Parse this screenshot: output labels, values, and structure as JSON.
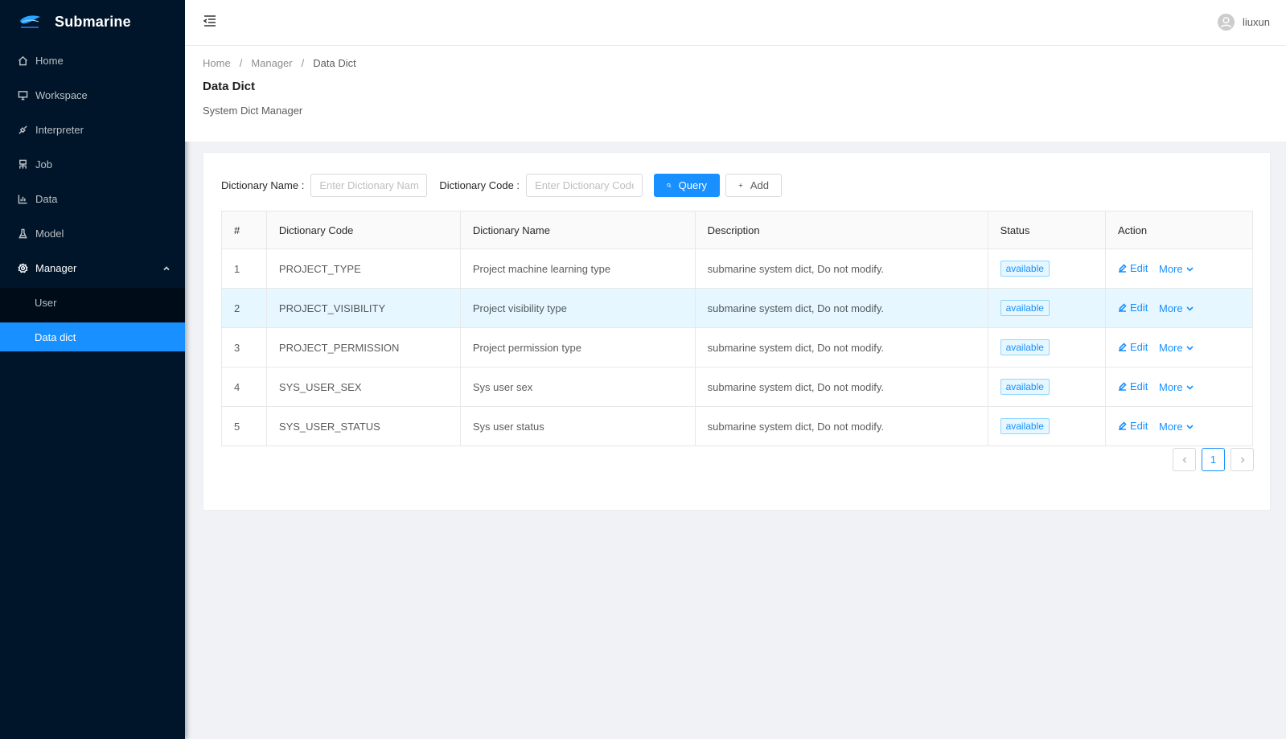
{
  "app": {
    "title": "Submarine"
  },
  "sidebar": {
    "items": [
      {
        "label": "Home",
        "icon": "home-icon"
      },
      {
        "label": "Workspace",
        "icon": "desktop-icon"
      },
      {
        "label": "Interpreter",
        "icon": "api-icon"
      },
      {
        "label": "Job",
        "icon": "cluster-icon"
      },
      {
        "label": "Data",
        "icon": "bar-chart-icon"
      },
      {
        "label": "Model",
        "icon": "experiment-icon"
      },
      {
        "label": "Manager",
        "icon": "gear-icon",
        "expanded": true
      }
    ],
    "submenu": [
      {
        "label": "User",
        "active": false
      },
      {
        "label": "Data dict",
        "active": true
      }
    ]
  },
  "header": {
    "username": "liuxun"
  },
  "breadcrumb": {
    "items": [
      "Home",
      "Manager",
      "Data Dict"
    ],
    "separator": "/"
  },
  "page": {
    "title": "Data Dict",
    "description": "System Dict Manager"
  },
  "search": {
    "name_label": "Dictionary Name :",
    "name_placeholder": "Enter Dictionary Name",
    "name_value": "",
    "code_label": "Dictionary Code :",
    "code_placeholder": "Enter Dictionary Code",
    "code_value": "",
    "query_label": "Query",
    "add_label": "Add"
  },
  "table": {
    "columns": [
      "#",
      "Dictionary Code",
      "Dictionary Name",
      "Description",
      "Status",
      "Action"
    ],
    "rows": [
      {
        "index": "1",
        "code": "PROJECT_TYPE",
        "name": "Project machine learning type",
        "description": "submarine system dict, Do not modify.",
        "status": "available",
        "edit": "Edit",
        "more": "More"
      },
      {
        "index": "2",
        "code": "PROJECT_VISIBILITY",
        "name": "Project visibility type",
        "description": "submarine system dict, Do not modify.",
        "status": "available",
        "edit": "Edit",
        "more": "More"
      },
      {
        "index": "3",
        "code": "PROJECT_PERMISSION",
        "name": "Project permission type",
        "description": "submarine system dict, Do not modify.",
        "status": "available",
        "edit": "Edit",
        "more": "More"
      },
      {
        "index": "4",
        "code": "SYS_USER_SEX",
        "name": "Sys user sex",
        "description": "submarine system dict, Do not modify.",
        "status": "available",
        "edit": "Edit",
        "more": "More"
      },
      {
        "index": "5",
        "code": "SYS_USER_STATUS",
        "name": "Sys user status",
        "description": "submarine system dict, Do not modify.",
        "status": "available",
        "edit": "Edit",
        "more": "More"
      }
    ]
  },
  "pagination": {
    "current": "1"
  },
  "colors": {
    "primary": "#1890ff",
    "sidebar_bg": "#001529",
    "submenu_bg": "#000c17",
    "row_highlight": "#e6f7ff"
  }
}
